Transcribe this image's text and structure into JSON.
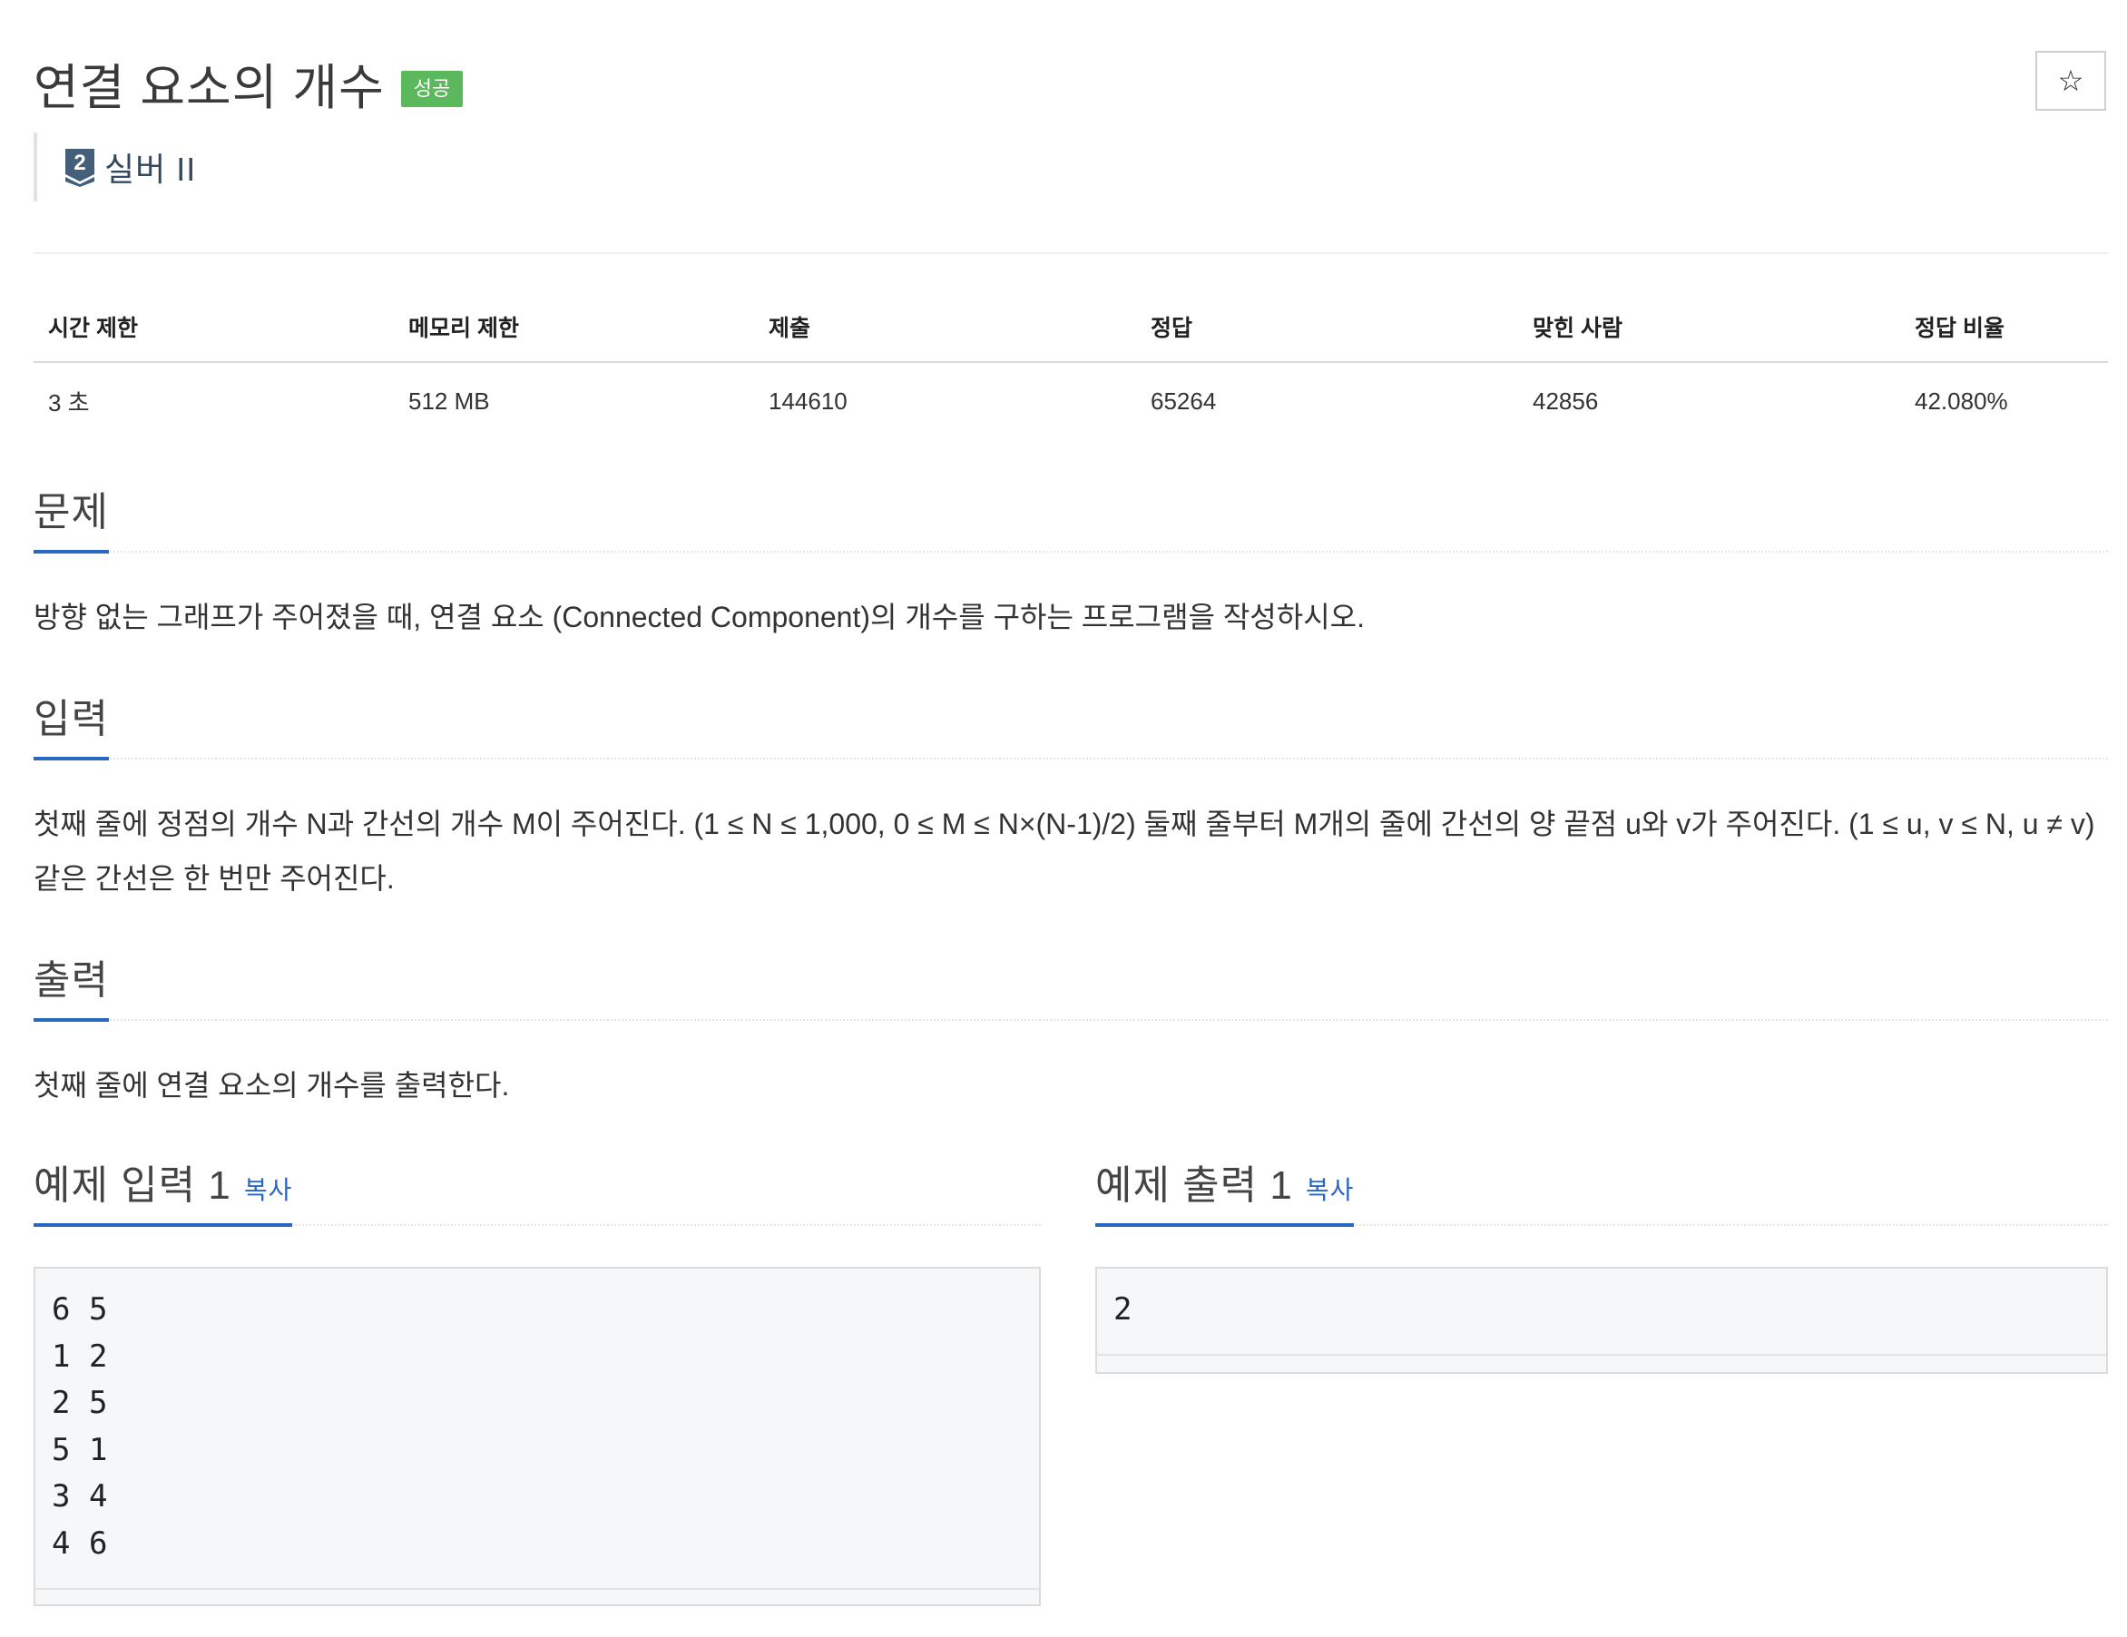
{
  "problem": {
    "title": "연결 요소의 개수",
    "status_badge": "성공",
    "star_icon": "☆",
    "tier_icon": "silver-2-tier-icon",
    "tier_number": "2",
    "tier_label": "실버 II"
  },
  "info": {
    "headers": [
      "시간 제한",
      "메모리 제한",
      "제출",
      "정답",
      "맞힌 사람",
      "정답 비율"
    ],
    "values": [
      "3 초",
      "512 MB",
      "144610",
      "65264",
      "42856",
      "42.080%"
    ]
  },
  "sections": {
    "problem": {
      "title": "문제",
      "text": "방향 없는 그래프가 주어졌을 때, 연결 요소 (Connected Component)의 개수를 구하는 프로그램을 작성하시오."
    },
    "input": {
      "title": "입력",
      "text": "첫째 줄에 정점의 개수 N과 간선의 개수 M이 주어진다. (1 ≤ N ≤ 1,000, 0 ≤ M ≤ N×(N-1)/2) 둘째 줄부터 M개의 줄에 간선의 양 끝점 u와 v가 주어진다. (1 ≤ u, v ≤ N, u ≠ v) 같은 간선은 한 번만 주어진다."
    },
    "output": {
      "title": "출력",
      "text": "첫째 줄에 연결 요소의 개수를 출력한다."
    }
  },
  "samples": {
    "input": {
      "title": "예제 입력 1",
      "copy_label": "복사",
      "lines": [
        "6 5",
        "1 2",
        "2 5",
        "5 1",
        "3 4",
        "4 6"
      ]
    },
    "output": {
      "title": "예제 출력 1",
      "copy_label": "복사",
      "lines": [
        "2"
      ]
    }
  }
}
